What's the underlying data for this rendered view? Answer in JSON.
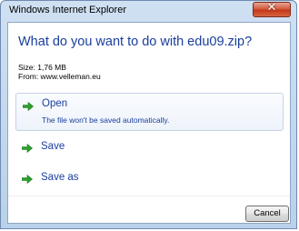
{
  "window": {
    "title": "Windows Internet Explorer",
    "close_icon": "close-icon"
  },
  "dialog": {
    "heading": "What do you want to do with edu09.zip?",
    "size_label": "Size: 1,76 MB",
    "from_label": "From: www.velleman.eu"
  },
  "options": [
    {
      "label": "Open",
      "sublabel": "The file won't be saved automatically.",
      "icon": "green-arrow-icon",
      "selected": true
    },
    {
      "label": "Save",
      "icon": "green-arrow-icon"
    },
    {
      "label": "Save as",
      "icon": "green-arrow-icon"
    }
  ],
  "buttons": {
    "cancel": "Cancel"
  },
  "colors": {
    "accent_text": "#1a3e9c",
    "arrow_green": "#2f9e2f"
  }
}
